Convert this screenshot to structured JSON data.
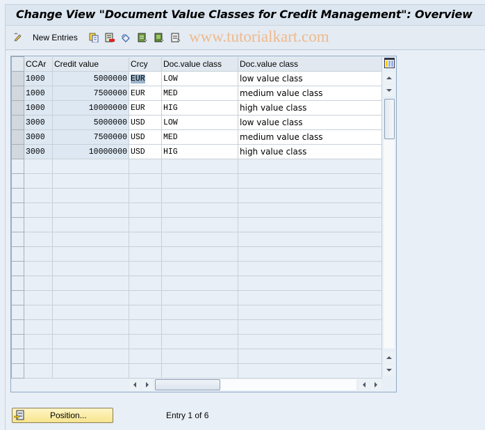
{
  "title": "Change View \"Document Value Classes for Credit Management\": Overview",
  "toolbar": {
    "new_entries_label": "New Entries",
    "watermark": "www.tutorialkart.com",
    "icons": [
      "display-change-icon",
      "copy-icon",
      "delete-icon",
      "undo-icon",
      "select-all-icon",
      "select-block-icon",
      "deselect-all-icon"
    ]
  },
  "table": {
    "columns": [
      "CCAr",
      "Credit value",
      "Crcy",
      "Doc.value class",
      "Doc.value class"
    ],
    "rows": [
      {
        "ccar": "1000",
        "credit": "5000000",
        "crcy": "EUR",
        "cls": "LOW",
        "desc": "low value class"
      },
      {
        "ccar": "1000",
        "credit": "7500000",
        "crcy": "EUR",
        "cls": "MED",
        "desc": "medium value class"
      },
      {
        "ccar": "1000",
        "credit": "10000000",
        "crcy": "EUR",
        "cls": "HIG",
        "desc": "high value class"
      },
      {
        "ccar": "3000",
        "credit": "5000000",
        "crcy": "USD",
        "cls": "LOW",
        "desc": "low value class"
      },
      {
        "ccar": "3000",
        "credit": "7500000",
        "crcy": "USD",
        "cls": "MED",
        "desc": "medium value class"
      },
      {
        "ccar": "3000",
        "credit": "10000000",
        "crcy": "USD",
        "cls": "HIG",
        "desc": "high value class"
      }
    ],
    "empty_rows": 15
  },
  "footer": {
    "position_label": "Position...",
    "entry_text": "Entry 1 of 6"
  }
}
